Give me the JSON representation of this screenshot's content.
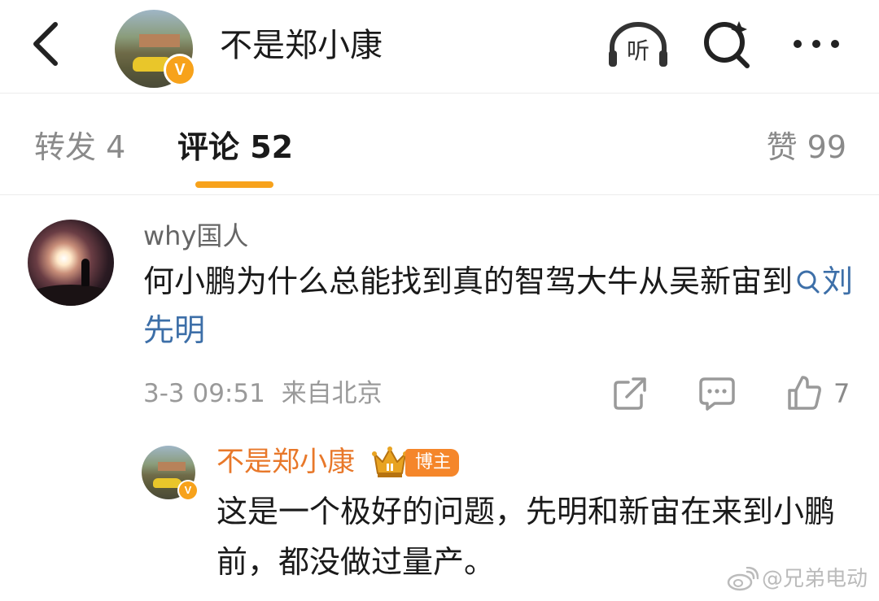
{
  "header": {
    "title": "不是郑小康",
    "listen_label": "听",
    "avatar_badge": "V",
    "icons": [
      "back-icon",
      "listen-icon",
      "search-icon",
      "more-icon"
    ]
  },
  "tabs": [
    {
      "label": "转发 4",
      "active": false
    },
    {
      "label": "评论 52",
      "active": true
    },
    {
      "label": "赞 99",
      "active": false
    }
  ],
  "comment": {
    "author": "why国人",
    "text": "何小鹏为什么总能找到真的智驾大牛从吴新宙到",
    "topic_link": "刘先明",
    "time": "3-3 09:51",
    "location": "来自北京",
    "like_count": "7",
    "icons": [
      "share-icon",
      "reply-icon",
      "like-icon"
    ]
  },
  "reply": {
    "author": "不是郑小康",
    "avatar_badge": "V",
    "badge": "博主",
    "text": "这是一个极好的问题，先明和新宙在来到小鹏前，都没做过量产。"
  },
  "watermark": "@兄弟电动",
  "colors": {
    "accent": "#f7a21b",
    "author_orange": "#e8782a",
    "link_blue": "#3d6fa8",
    "muted": "#9a9a9a"
  }
}
